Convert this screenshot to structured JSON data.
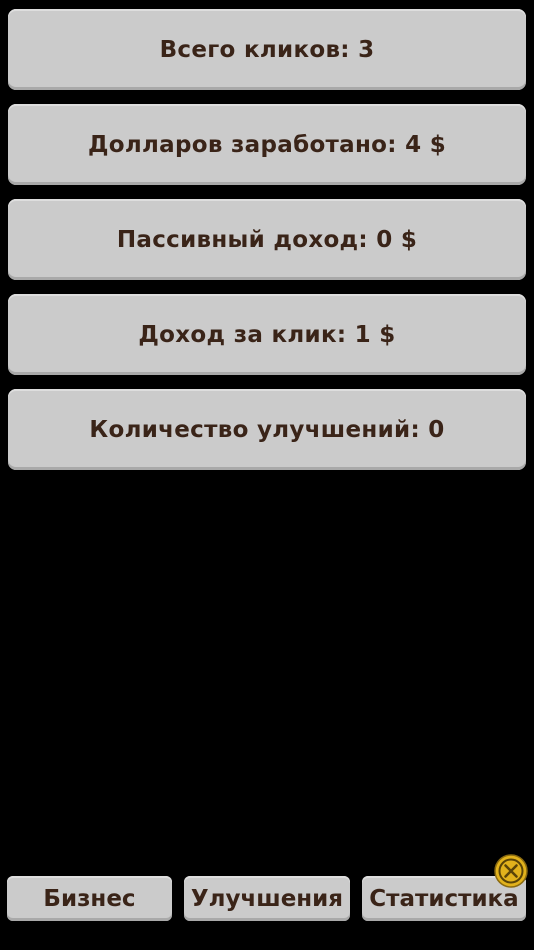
{
  "stats": [
    {
      "label": "Всего кликов: 3"
    },
    {
      "label": "Долларов заработано: 4 $"
    },
    {
      "label": "Пассивный доход: 0 $"
    },
    {
      "label": "Доход за клик: 1 $"
    },
    {
      "label": "Количество улучшений: 0"
    }
  ],
  "tabs": {
    "business": "Бизнес",
    "upgrades": "Улучшения",
    "statistics": "Статистика"
  },
  "colors": {
    "background": "#000000",
    "card": "#cbcbcb",
    "text": "#3a2418",
    "badge": "#e2b21c"
  },
  "icons": {
    "ad_badge": "close-circle-icon"
  }
}
